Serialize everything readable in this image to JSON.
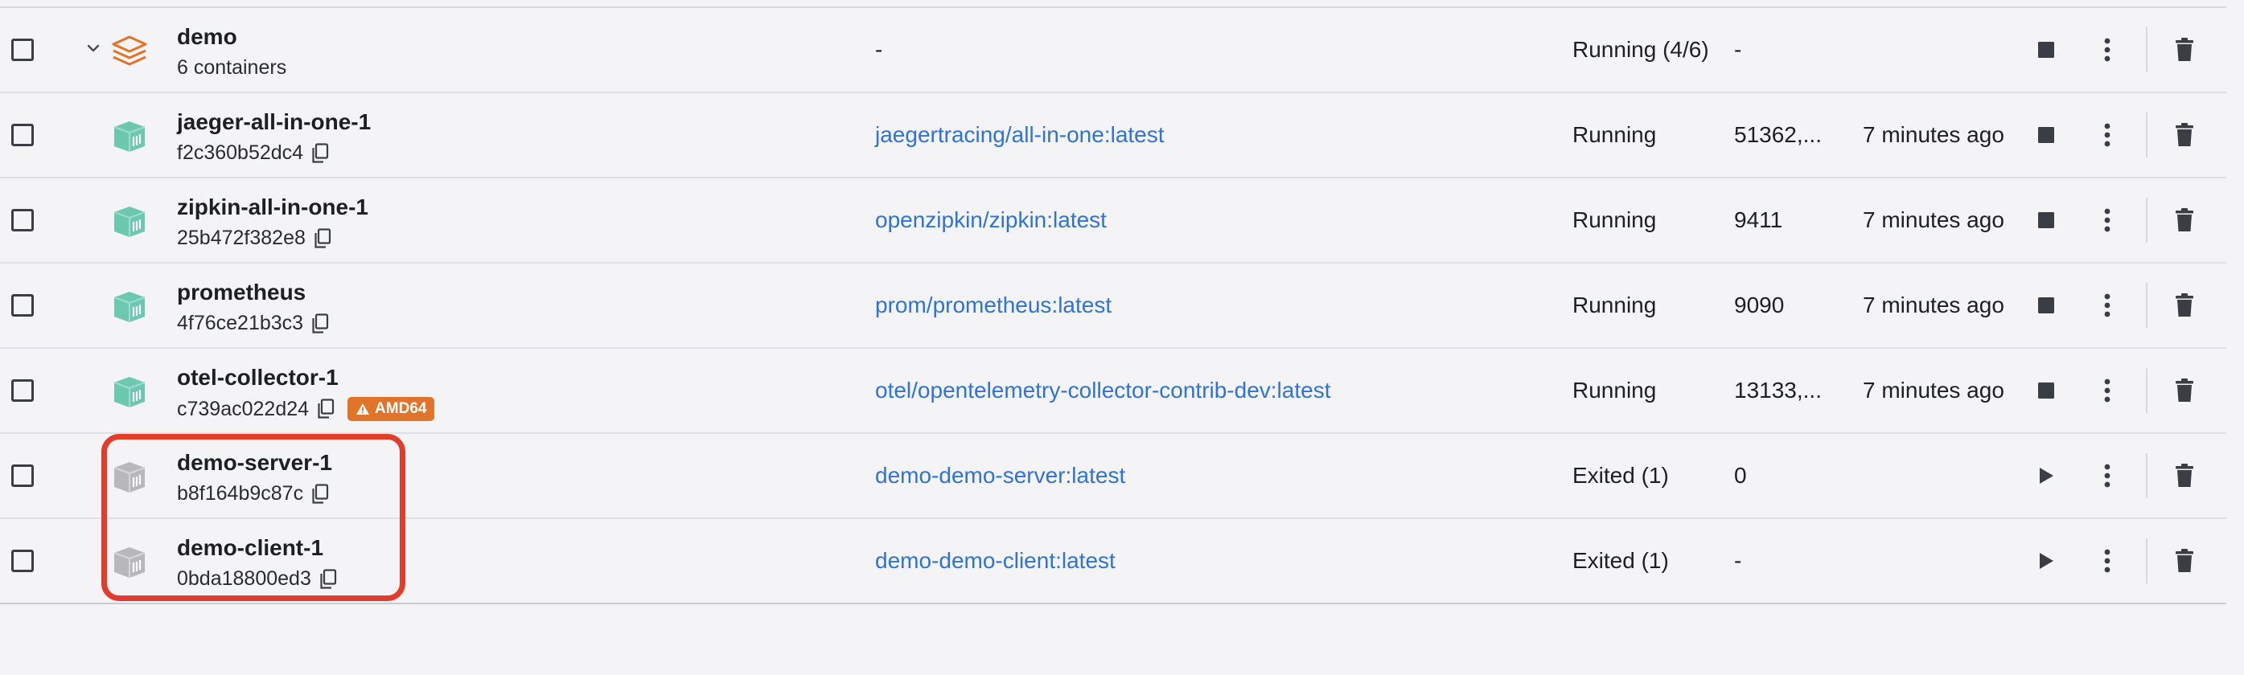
{
  "colors": {
    "link": "#2f72d8",
    "running_icon": "#6cc8b0",
    "exited_icon": "#b8b8bc",
    "compose_icon": "#e0742a",
    "warning_badge": "#e0742a",
    "highlight": "#e23c2c"
  },
  "rows": [
    {
      "type": "compose",
      "name": "demo",
      "subtitle": "6 containers",
      "image": "-",
      "status": "Running (4/6)",
      "port": "-",
      "age": "",
      "main_action": "stop-icon"
    },
    {
      "type": "container",
      "state": "running",
      "name": "jaeger-all-in-one-1",
      "id": "f2c360b52dc4",
      "image": "jaegertracing/all-in-one:latest",
      "status": "Running",
      "port": "51362,...",
      "age": "7 minutes ago",
      "main_action": "stop-icon"
    },
    {
      "type": "container",
      "state": "running",
      "name": "zipkin-all-in-one-1",
      "id": "25b472f382e8",
      "image": "openzipkin/zipkin:latest",
      "status": "Running",
      "port": "9411",
      "age": "7 minutes ago",
      "main_action": "stop-icon"
    },
    {
      "type": "container",
      "state": "running",
      "name": "prometheus",
      "id": "4f76ce21b3c3",
      "image": "prom/prometheus:latest",
      "status": "Running",
      "port": "9090",
      "age": "7 minutes ago",
      "main_action": "stop-icon"
    },
    {
      "type": "container",
      "state": "running",
      "name": "otel-collector-1",
      "id": "c739ac022d24",
      "badge": "AMD64",
      "image": "otel/opentelemetry-collector-contrib-dev:latest",
      "status": "Running",
      "port": "13133,...",
      "age": "7 minutes ago",
      "main_action": "stop-icon"
    },
    {
      "type": "container",
      "state": "exited",
      "name": "demo-server-1",
      "id": "b8f164b9c87c",
      "image": "demo-demo-server:latest",
      "status": "Exited (1)",
      "port": "0",
      "age": "",
      "main_action": "play-icon"
    },
    {
      "type": "container",
      "state": "exited",
      "name": "demo-client-1",
      "id": "0bda18800ed3",
      "image": "demo-demo-client:latest",
      "status": "Exited (1)",
      "port": "-",
      "age": "",
      "main_action": "play-icon"
    }
  ]
}
